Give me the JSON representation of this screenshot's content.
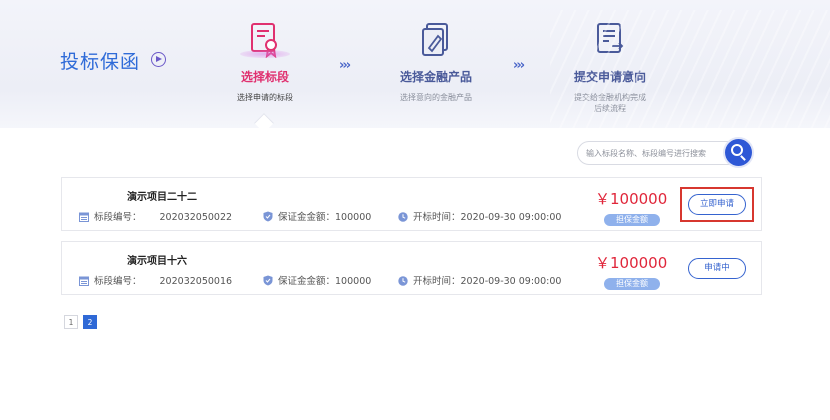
{
  "brand": {
    "title": "投标保函",
    "play_icon": "play-circle-icon"
  },
  "steps": [
    {
      "title": "选择标段",
      "subtitle": "选择申请的标段",
      "icon": "certificate-icon",
      "active": true
    },
    {
      "title": "选择金融产品",
      "subtitle": "选择意向的金融产品",
      "icon": "document-edit-icon",
      "active": false
    },
    {
      "title": "提交申请意向",
      "subtitle_line1": "提交给金融机构完成",
      "subtitle_line2": "后续流程",
      "icon": "submit-form-icon",
      "active": false
    }
  ],
  "step_separator": "›››",
  "search": {
    "placeholder": "输入标段名称、标段编号进行搜索",
    "value": ""
  },
  "projects": [
    {
      "name": "演示项目二十二",
      "code_label": "标段编号：",
      "code_value": "202032050022",
      "guarantee_label": "保证金金额：",
      "guarantee_value": "100000",
      "open_label": "开标时间：",
      "open_value": "2020-09-30 09:00:00",
      "amount": "￥100000",
      "amount_tag": "担保金额",
      "action": "立即申请"
    },
    {
      "name": "演示项目十六",
      "code_label": "标段编号：",
      "code_value": "202032050016",
      "guarantee_label": "保证金金额：",
      "guarantee_value": "100000",
      "open_label": "开标时间：",
      "open_value": "2020-09-30 09:00:00",
      "amount": "￥100000",
      "amount_tag": "担保金额",
      "action": "申请中"
    }
  ],
  "pagination": {
    "pages": [
      "1",
      "2"
    ],
    "current": "2"
  },
  "colors": {
    "accent": "#2f69d6",
    "active_step": "#e0306f",
    "amount": "#e0263a",
    "highlight": "#d7372f"
  }
}
